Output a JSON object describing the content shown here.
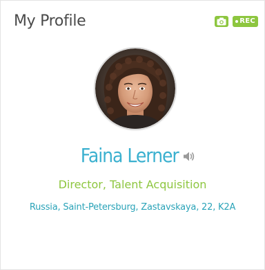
{
  "card": {
    "title": "My Profile",
    "rec_label": "REC",
    "camera_icon": "camera-icon",
    "rec_icon": "rec-dot-icon"
  },
  "profile": {
    "name": "Faina Lerner",
    "speaker_icon": "speaker-icon",
    "job_title": "Director, Talent Acquisition",
    "address": "Russia, Saint-Petersburg, Zastavskaya, 22, K2A"
  },
  "colors": {
    "title_text": "#4a4a4a",
    "accent_green": "#8dc63f",
    "name_blue": "#3ab0cf",
    "job_green": "#8dc63f",
    "address_blue": "#2aa3b8",
    "icon_grey": "#9a9a9a"
  }
}
